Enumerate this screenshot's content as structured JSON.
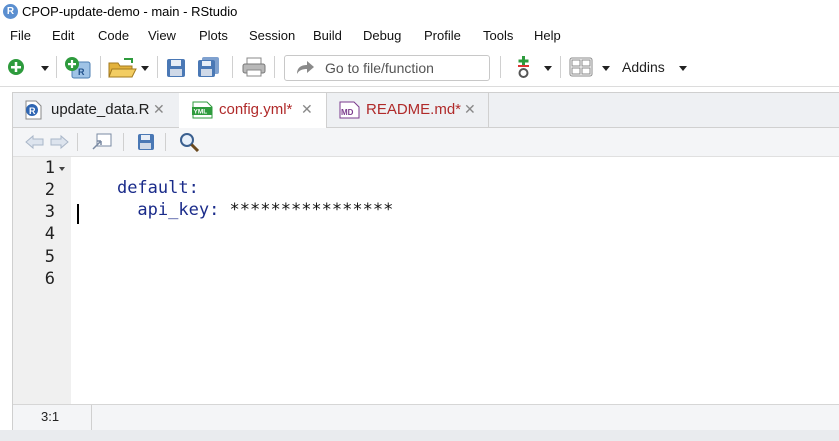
{
  "window": {
    "title": "CPOP-update-demo - main - RStudio",
    "logo": "R"
  },
  "menu": [
    "File",
    "Edit",
    "Code",
    "View",
    "Plots",
    "Session",
    "Build",
    "Debug",
    "Profile",
    "Tools",
    "Help"
  ],
  "toolbar": {
    "goto_placeholder": "Go to file/function",
    "addins_label": "Addins"
  },
  "tabs": [
    {
      "label": "update_data.R",
      "icon": "r-file-icon",
      "color": "#1f1f1f",
      "active": false
    },
    {
      "label": "config.yml*",
      "icon": "yml-file-icon",
      "color": "#b02a2a",
      "active": true
    },
    {
      "label": "README.md*",
      "icon": "md-file-icon",
      "color": "#b02a2a",
      "active": false
    }
  ],
  "editor": {
    "line_numbers": [
      "1",
      "2",
      "3",
      "4",
      "5",
      "6"
    ],
    "lines": [
      {
        "key": "default:",
        "value": ""
      },
      {
        "key": "  api_key:",
        "value": " ****************"
      }
    ]
  },
  "status": {
    "cursor_position": "3:1"
  },
  "colors": {
    "accent_green": "#2e9b3d",
    "keyword_blue": "#1a2b8a",
    "modified_red": "#b02a2a"
  }
}
